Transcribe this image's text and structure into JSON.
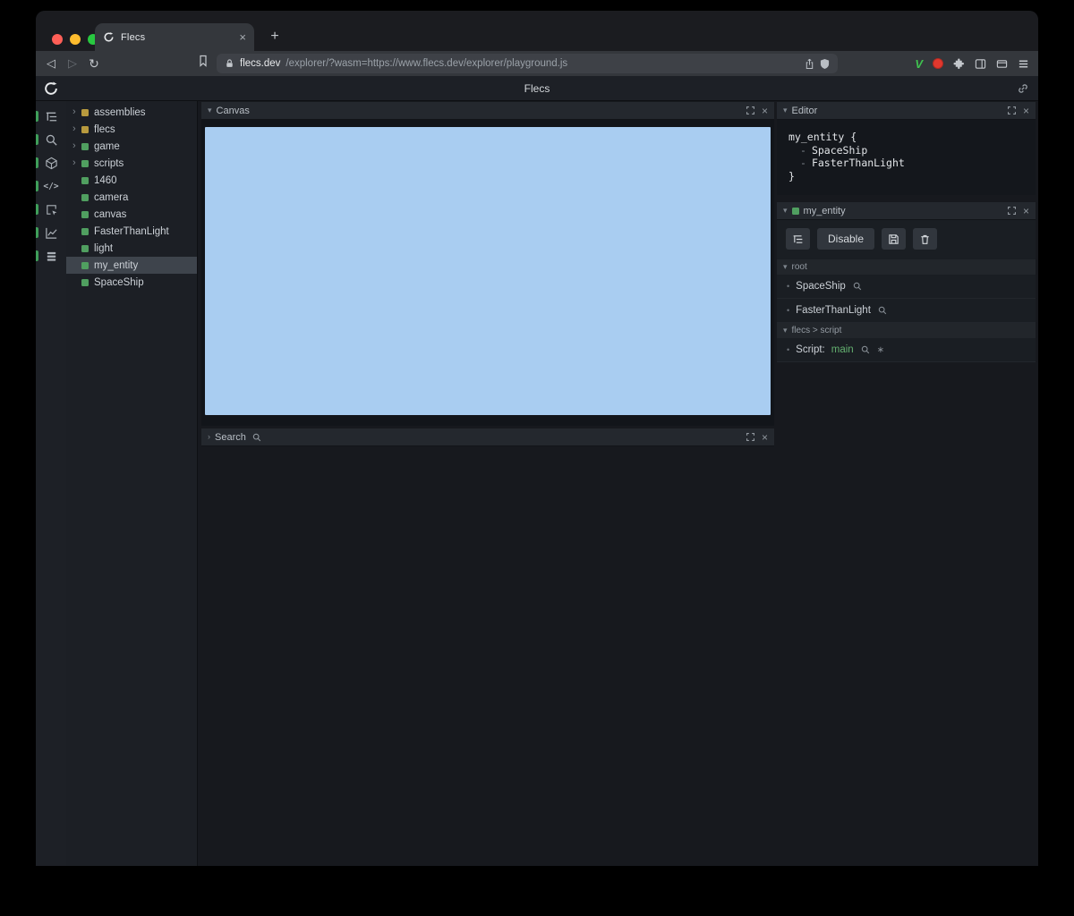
{
  "icons": {
    "chevron_down": "▾",
    "chevron_right": "›",
    "close": "×",
    "plus": "+",
    "bullet": "•",
    "back": "◁",
    "forward": "▷",
    "reload": "↻",
    "asterisk": "∗"
  },
  "browser": {
    "tab_title": "Flecs",
    "url_domain": "flecs.dev",
    "url_path": "/explorer/?wasm=https://www.flecs.dev/explorer/playground.js",
    "extension_v_label": "V"
  },
  "app": {
    "title": "Flecs"
  },
  "rail": {
    "icons": [
      "outliner",
      "search",
      "entities",
      "code",
      "inspector",
      "stats",
      "logs"
    ]
  },
  "tree": {
    "items": [
      {
        "label": "assemblies",
        "color": "#b89a3e",
        "expandable": true
      },
      {
        "label": "flecs",
        "color": "#b89a3e",
        "expandable": true
      },
      {
        "label": "game",
        "color": "#509f60",
        "expandable": true
      },
      {
        "label": "scripts",
        "color": "#509f60",
        "expandable": true
      },
      {
        "label": "1460",
        "color": "#509f60",
        "expandable": false
      },
      {
        "label": "camera",
        "color": "#509f60",
        "expandable": false
      },
      {
        "label": "canvas",
        "color": "#509f60",
        "expandable": false
      },
      {
        "label": "FasterThanLight",
        "color": "#509f60",
        "expandable": false
      },
      {
        "label": "light",
        "color": "#509f60",
        "expandable": false
      },
      {
        "label": "my_entity",
        "color": "#509f60",
        "expandable": false,
        "selected": true
      },
      {
        "label": "SpaceShip",
        "color": "#509f60",
        "expandable": false
      }
    ]
  },
  "panels": {
    "canvas": {
      "title": "Canvas",
      "surface_color": "#a9cdf1"
    },
    "search": {
      "title": "Search"
    },
    "editor": {
      "title": "Editor",
      "code": {
        "open": "my_entity {",
        "dash": "-",
        "components": [
          "SpaceShip",
          "FasterThanLight"
        ],
        "close": "}"
      }
    },
    "entity": {
      "title": "my_entity",
      "square_color": "#509f60",
      "buttons": {
        "disable": "Disable"
      },
      "sections": [
        {
          "title": "root",
          "items": [
            {
              "name": "SpaceShip"
            },
            {
              "name": "FasterThanLight"
            }
          ]
        },
        {
          "title": "flecs > script",
          "items": [
            {
              "label": "Script:",
              "name": "main"
            }
          ]
        }
      ]
    }
  }
}
